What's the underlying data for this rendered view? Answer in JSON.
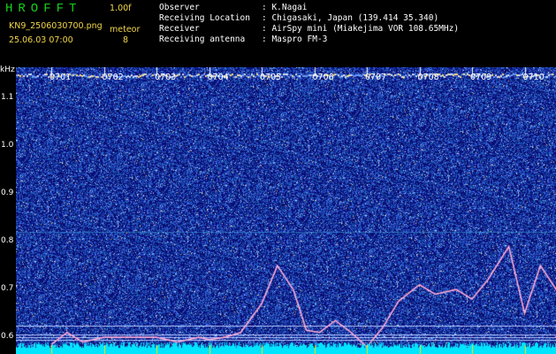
{
  "header": {
    "title": "HROFFT",
    "version": "1.00f",
    "filename": "KN9_2506030700.png",
    "datetime": "25.06.03 07:00",
    "meteor_label": "meteor",
    "meteor_count": "8",
    "labels": [
      "Observer",
      "Receiving Location",
      "Receiver",
      "Receiving antenna"
    ],
    "values": [
      ": K.Nagai",
      ": Chigasaki, Japan (139.414 35.340)",
      ": AirSpy mini (Miakejima VOR 108.65MHz)",
      ": Maspro FM-3"
    ]
  },
  "colors": {
    "background": "#000000",
    "title": "#16d21a",
    "label": "#f2d64a",
    "text": "#ffffff",
    "noise_bg": "#1a2a8c",
    "band_bottom": "#00e5ff"
  },
  "chart_data": {
    "type": "heatmap",
    "ylabel": "kHz",
    "yticks": [
      "1.1",
      "1.0",
      "0.9",
      "0.8",
      "0.7",
      "0.6"
    ],
    "ytick_values": [
      1.1,
      1.0,
      0.9,
      0.8,
      0.7,
      0.6
    ],
    "ylim": [
      0.565,
      1.165
    ],
    "xticks": [
      "0701",
      "0702",
      "0703",
      "0704",
      "0705",
      "0706",
      "0707",
      "0708",
      "0709",
      "0710"
    ],
    "trace": {
      "minute": [
        0.0,
        0.3,
        0.6,
        1.0,
        1.3,
        1.6,
        2.0,
        2.4,
        2.8,
        3.0,
        3.3,
        3.6,
        4.0,
        4.3,
        4.6,
        4.85,
        5.1,
        5.4,
        5.7,
        6.0,
        6.3,
        6.6,
        7.0,
        7.3,
        7.7,
        8.0,
        8.3,
        8.7,
        9.0,
        9.3,
        9.6,
        9.83,
        10.0
      ],
      "khz": [
        0.585,
        0.61,
        0.59,
        0.6,
        0.6,
        0.6,
        0.6,
        0.59,
        0.6,
        0.595,
        0.6,
        0.61,
        0.67,
        0.75,
        0.7,
        0.615,
        0.61,
        0.635,
        0.61,
        0.58,
        0.62,
        0.675,
        0.71,
        0.69,
        0.7,
        0.68,
        0.72,
        0.79,
        0.65,
        0.75,
        0.7,
        0.79,
        0.7
      ]
    },
    "hlines_khz": [
      0.625,
      0.605,
      0.6,
      0.595
    ],
    "faint_line_khz": 0.82,
    "top_band_khz": 1.15
  }
}
